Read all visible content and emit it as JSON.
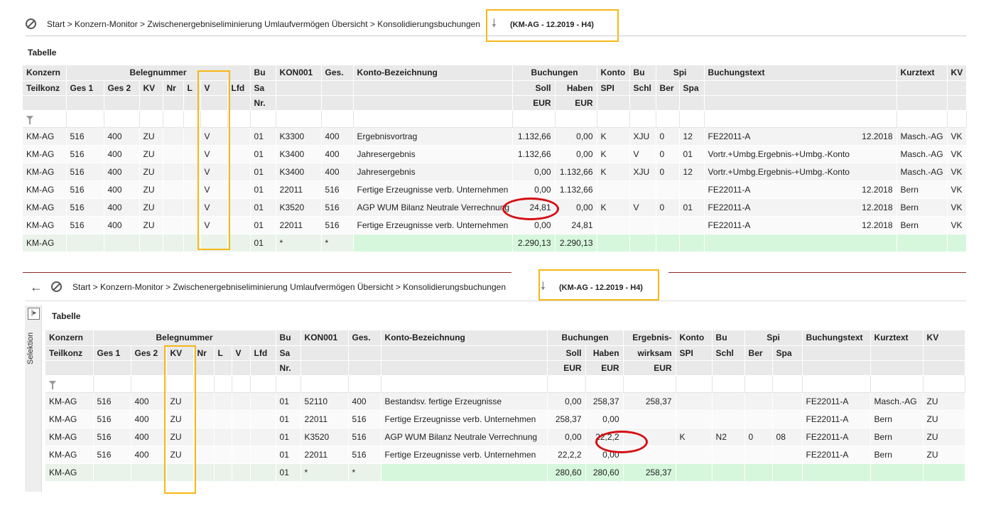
{
  "top": {
    "breadcrumb": "Start > Konzern-Monitor > Zwischenergebniseliminierung Umlaufvermögen Übersicht > Konsolidierungsbuchungen",
    "context": "(KM-AG - 12.2019 - H4)",
    "table_title": "Tabelle",
    "header1": [
      "Konzern",
      "Belegnummer",
      "Bu",
      "KON001",
      "Ges.",
      "Konto-Bezeichnung",
      "Buchungen",
      "Konto",
      "Bu",
      "Spi",
      "Buchungstext",
      "Kurztext",
      "KV"
    ],
    "header2": [
      "Teilkonz",
      "Ges 1",
      "Ges 2",
      "KV",
      "Nr",
      "L",
      "V",
      "Lfd",
      "Sa",
      "Soll",
      "Haben",
      "SPI",
      "Schl",
      "Ber",
      "Spa"
    ],
    "header3": [
      "Nr.",
      "EUR",
      "EUR"
    ],
    "rows": [
      [
        "KM-AG",
        "516",
        "400",
        "ZU",
        "",
        "",
        "V",
        "",
        "01",
        "K3300",
        "400",
        "Ergebnisvortrag",
        "1.132,66",
        "0,00",
        "K",
        "XJU",
        "0",
        "12",
        "FE22011-A",
        "12.2018",
        "Masch.-AG",
        "VK"
      ],
      [
        "KM-AG",
        "516",
        "400",
        "ZU",
        "",
        "",
        "V",
        "",
        "01",
        "K3400",
        "400",
        "Jahresergebnis",
        "1.132,66",
        "0,00",
        "K",
        "V",
        "0",
        "01",
        "Vortr.+Umbg.Ergebnis-+Umbg.-Konto",
        "",
        "Masch.-AG",
        "VK"
      ],
      [
        "KM-AG",
        "516",
        "400",
        "ZU",
        "",
        "",
        "V",
        "",
        "01",
        "K3400",
        "400",
        "Jahresergebnis",
        "0,00",
        "1.132,66",
        "K",
        "XJU",
        "0",
        "12",
        "Vortr.+Umbg.Ergebnis-+Umbg.-Konto",
        "",
        "Masch.-AG",
        "VK"
      ],
      [
        "KM-AG",
        "516",
        "400",
        "ZU",
        "",
        "",
        "V",
        "",
        "01",
        "22011",
        "516",
        "Fertige Erzeugnisse verb. Unternehmen",
        "0,00",
        "1.132,66",
        "",
        "",
        "",
        "",
        "FE22011-A",
        "12.2018",
        "Bern",
        "VK"
      ],
      [
        "KM-AG",
        "516",
        "400",
        "ZU",
        "",
        "",
        "V",
        "",
        "01",
        "K3520",
        "516",
        "AGP WUM Bilanz Neutrale Verrechnung",
        "24,81",
        "0,00",
        "K",
        "V",
        "0",
        "01",
        "FE22011-A",
        "12.2018",
        "Bern",
        "VK"
      ],
      [
        "KM-AG",
        "516",
        "400",
        "ZU",
        "",
        "",
        "V",
        "",
        "01",
        "22011",
        "516",
        "Fertige Erzeugnisse verb. Unternehmen",
        "0,00",
        "24,81",
        "",
        "",
        "",
        "",
        "FE22011-A",
        "12.2018",
        "Bern",
        "VK"
      ]
    ],
    "sum": {
      "konzern": "KM-AG",
      "bu": "01",
      "kon": "*",
      "ges": "*",
      "soll": "2.290,13",
      "haben": "2.290,13"
    }
  },
  "bottom": {
    "breadcrumb": "Start > Konzern-Monitor > Zwischenergebniseliminierung Umlaufvermögen Übersicht > Konsolidierungsbuchungen",
    "context": "(KM-AG - 12.2019 - H4)",
    "table_title": "Tabelle",
    "side_tab": "Selektion",
    "header1": [
      "Konzern",
      "Belegnummer",
      "Bu",
      "KON001",
      "Ges.",
      "Konto-Bezeichnung",
      "Buchungen",
      "Ergebnis-",
      "Konto",
      "Bu",
      "Spi",
      "Buchungstext",
      "Kurztext",
      "KV"
    ],
    "header2": [
      "Teilkonz",
      "Ges 1",
      "Ges 2",
      "KV",
      "Nr",
      "L",
      "V",
      "Lfd",
      "Sa",
      "Soll",
      "Haben",
      "wirksam",
      "SPI",
      "Schl",
      "Ber",
      "Spa"
    ],
    "header3": [
      "Nr.",
      "EUR",
      "EUR",
      "EUR"
    ],
    "rows": [
      [
        "KM-AG",
        "516",
        "400",
        "ZU",
        "",
        "",
        "",
        "",
        "01",
        "52110",
        "400",
        "Bestandsv. fertige Erzeugnisse",
        "0,00",
        "258,37",
        "258,37",
        "",
        "",
        "",
        "",
        "FE22011-A",
        "Masch.-AG",
        "ZU"
      ],
      [
        "KM-AG",
        "516",
        "400",
        "ZU",
        "",
        "",
        "",
        "",
        "01",
        "22011",
        "516",
        "Fertige Erzeugnisse verb. Unternehmen",
        "258,37",
        "0,00",
        "",
        "",
        "",
        "",
        "",
        "FE22011-A",
        "Bern",
        "ZU"
      ],
      [
        "KM-AG",
        "516",
        "400",
        "ZU",
        "",
        "",
        "",
        "",
        "01",
        "K3520",
        "516",
        "AGP WUM Bilanz Neutrale Verrechnung",
        "0,00",
        "22,2,2",
        "",
        "K",
        "N2",
        "0",
        "08",
        "FE22011-A",
        "Bern",
        "ZU"
      ],
      [
        "KM-AG",
        "516",
        "400",
        "ZU",
        "",
        "",
        "",
        "",
        "01",
        "22011",
        "516",
        "Fertige Erzeugnisse verb. Unternehmen",
        "22,2,2",
        "0,00",
        "",
        "",
        "",
        "",
        "",
        "FE22011-A",
        "Bern",
        "ZU"
      ]
    ],
    "sum": {
      "konzern": "KM-AG",
      "bu": "01",
      "kon": "*",
      "ges": "*",
      "soll": "280,60",
      "haben": "280,60",
      "erg": "258,37"
    }
  },
  "colors": {
    "highlight": "#f6b817",
    "circle": "#d40f14",
    "sum_green": "#d6f7dc",
    "divider": "#8b2a2a"
  }
}
